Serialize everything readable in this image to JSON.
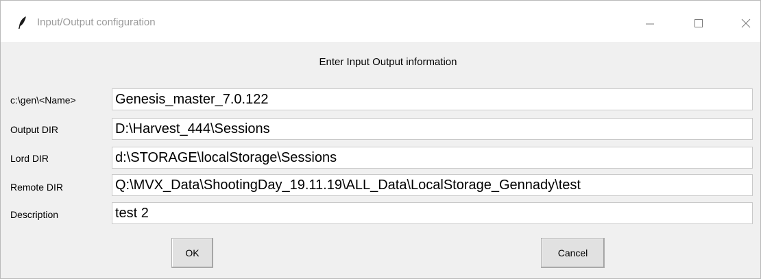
{
  "window": {
    "title": "Input/Output configuration",
    "title_icon": "feather-icon",
    "controls": [
      "minimize-icon",
      "maximize-icon",
      "close-icon"
    ]
  },
  "form": {
    "heading": "Enter Input Output information",
    "rows": [
      {
        "label": "c:\\gen\\<Name>",
        "value": "Genesis_master_7.0.122"
      },
      {
        "label": "Output DIR",
        "value": "D:\\Harvest_444\\Sessions"
      },
      {
        "label": "Lord DIR",
        "value": "d:\\STORAGE\\localStorage\\Sessions"
      },
      {
        "label": "Remote DIR",
        "value": "Q:\\MVX_Data\\ShootingDay_19.11.19\\ALL_Data\\LocalStorage_Gennady\\test"
      },
      {
        "label": "Description",
        "value": "test 2"
      }
    ]
  },
  "buttons": {
    "ok": "OK",
    "cancel": "Cancel"
  }
}
